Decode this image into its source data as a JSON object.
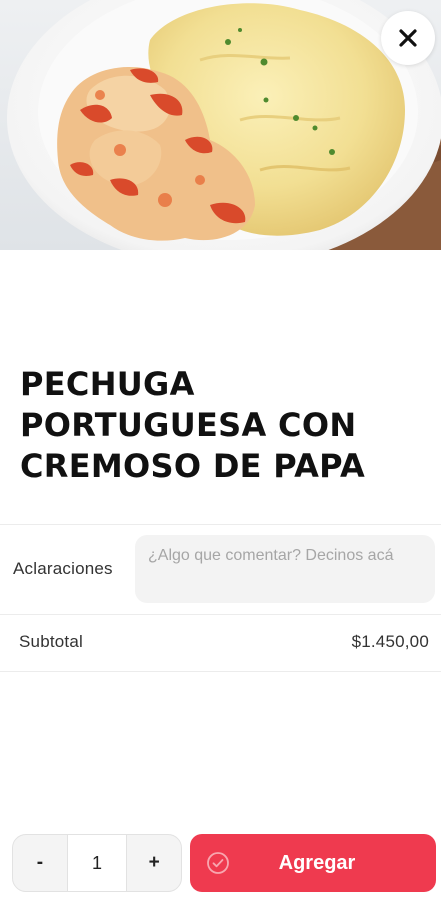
{
  "hero": {
    "image_icon": "plated-chicken-and-mashed-potatoes-photo"
  },
  "close_icon": "close-icon",
  "product": {
    "title_lines": [
      "PECHUGA",
      "PORTUGUESA CON",
      "CREMOSO DE PAPA"
    ]
  },
  "clarifications": {
    "label": "Aclaraciones",
    "placeholder": "¿Algo que comentar? Decinos acá",
    "value": ""
  },
  "subtotal": {
    "label": "Subtotal",
    "amount": "$1.450,00"
  },
  "quantity": {
    "decrement_label": "-",
    "value": "1",
    "increment_label": "+"
  },
  "add_button": {
    "label": "Agregar",
    "icon": "check-circle-icon"
  },
  "colors": {
    "accent": "#ef3a4f",
    "input_background": "#f3f3f3",
    "divider": "#ececec"
  }
}
